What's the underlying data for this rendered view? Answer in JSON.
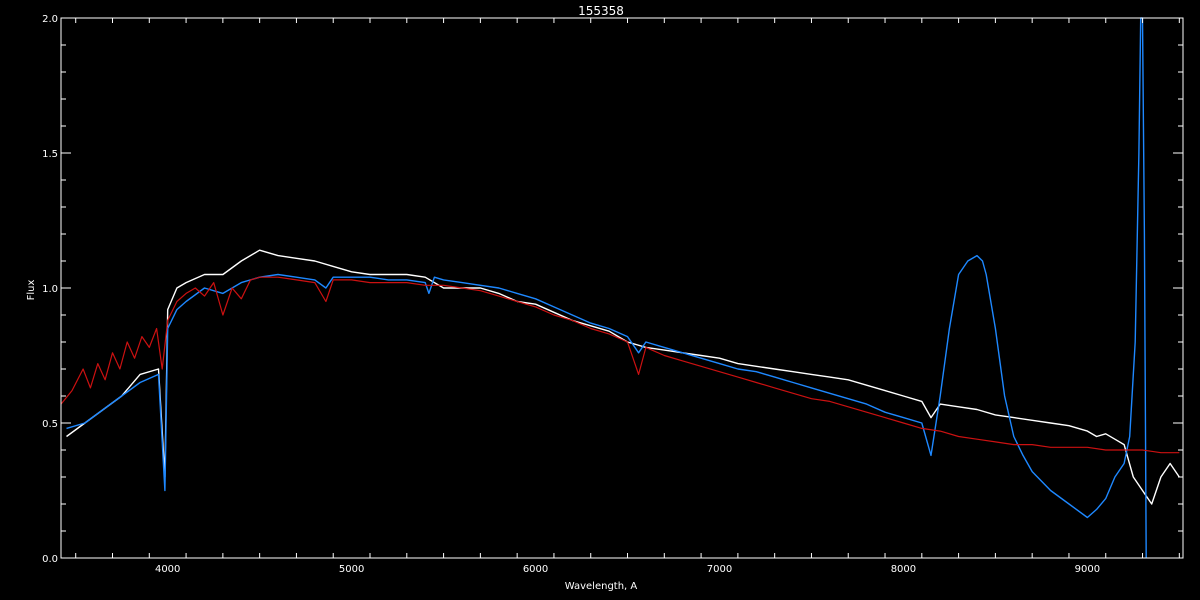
{
  "chart_data": {
    "type": "line",
    "title": "155358",
    "xlabel": "Wavelength, A",
    "ylabel": "Flux",
    "xlim": [
      3420,
      9520
    ],
    "ylim": [
      0.0,
      2.0
    ],
    "x_ticks": [
      4000,
      5000,
      6000,
      7000,
      8000,
      9000
    ],
    "x_tick_labels": [
      "4000",
      "5000",
      "6000",
      "7000",
      "8000",
      "9000"
    ],
    "y_ticks": [
      0.0,
      0.5,
      1.0,
      1.5,
      2.0
    ],
    "y_tick_labels": [
      "0.0",
      "0.5",
      "1.0",
      "1.5",
      "2.0"
    ],
    "grid": false,
    "background": "#000000",
    "series": [
      {
        "color": "#ffffff",
        "x": [
          3450,
          3550,
          3650,
          3750,
          3850,
          3950,
          3985,
          4000,
          4050,
          4100,
          4200,
          4300,
          4400,
          4500,
          4600,
          4700,
          4800,
          4900,
          5000,
          5100,
          5200,
          5300,
          5400,
          5500,
          5600,
          5700,
          5800,
          5900,
          6000,
          6100,
          6200,
          6300,
          6400,
          6500,
          6600,
          6700,
          6800,
          6900,
          7000,
          7100,
          7200,
          7300,
          7400,
          7500,
          7600,
          7700,
          7800,
          7900,
          8000,
          8100,
          8150,
          8200,
          8300,
          8400,
          8500,
          8600,
          8700,
          8800,
          8900,
          9000,
          9050,
          9100,
          9150,
          9200,
          9250,
          9300,
          9350,
          9400,
          9450,
          9500
        ],
        "y": [
          0.45,
          0.5,
          0.55,
          0.6,
          0.68,
          0.7,
          0.3,
          0.92,
          1.0,
          1.02,
          1.05,
          1.05,
          1.1,
          1.14,
          1.12,
          1.11,
          1.1,
          1.08,
          1.06,
          1.05,
          1.05,
          1.05,
          1.04,
          1.0,
          1.0,
          1.0,
          0.98,
          0.95,
          0.94,
          0.91,
          0.88,
          0.86,
          0.84,
          0.8,
          0.78,
          0.77,
          0.76,
          0.75,
          0.74,
          0.72,
          0.71,
          0.7,
          0.69,
          0.68,
          0.67,
          0.66,
          0.64,
          0.62,
          0.6,
          0.58,
          0.52,
          0.57,
          0.56,
          0.55,
          0.53,
          0.52,
          0.51,
          0.5,
          0.49,
          0.47,
          0.45,
          0.46,
          0.44,
          0.42,
          0.3,
          0.25,
          0.2,
          0.3,
          0.35,
          0.3
        ]
      },
      {
        "color": "#1e88ff",
        "x": [
          3450,
          3550,
          3650,
          3750,
          3850,
          3950,
          3985,
          4000,
          4050,
          4100,
          4200,
          4300,
          4400,
          4500,
          4600,
          4700,
          4800,
          4860,
          4900,
          5000,
          5100,
          5200,
          5300,
          5400,
          5420,
          5450,
          5500,
          5600,
          5700,
          5800,
          5900,
          6000,
          6100,
          6200,
          6300,
          6400,
          6500,
          6560,
          6600,
          6700,
          6800,
          6900,
          7000,
          7100,
          7200,
          7300,
          7400,
          7500,
          7600,
          7700,
          7800,
          7900,
          8000,
          8100,
          8150,
          8200,
          8250,
          8300,
          8350,
          8400,
          8430,
          8450,
          8500,
          8550,
          8600,
          8650,
          8700,
          8800,
          8900,
          9000,
          9050,
          9100,
          9150,
          9200,
          9230,
          9260,
          9280,
          9290,
          9300,
          9310,
          9320
        ],
        "y": [
          0.48,
          0.5,
          0.55,
          0.6,
          0.65,
          0.68,
          0.25,
          0.85,
          0.92,
          0.95,
          1.0,
          0.98,
          1.02,
          1.04,
          1.05,
          1.04,
          1.03,
          1.0,
          1.04,
          1.04,
          1.04,
          1.03,
          1.03,
          1.02,
          0.98,
          1.04,
          1.03,
          1.02,
          1.01,
          1.0,
          0.98,
          0.96,
          0.93,
          0.9,
          0.87,
          0.85,
          0.82,
          0.76,
          0.8,
          0.78,
          0.76,
          0.74,
          0.72,
          0.7,
          0.69,
          0.67,
          0.65,
          0.63,
          0.61,
          0.59,
          0.57,
          0.54,
          0.52,
          0.5,
          0.38,
          0.6,
          0.85,
          1.05,
          1.1,
          1.12,
          1.1,
          1.05,
          0.85,
          0.6,
          0.45,
          0.38,
          0.32,
          0.25,
          0.2,
          0.15,
          0.18,
          0.22,
          0.3,
          0.35,
          0.45,
          0.8,
          1.5,
          2.0,
          2.0,
          1.2,
          0.0
        ]
      },
      {
        "color": "#cc1111",
        "x": [
          3420,
          3480,
          3540,
          3580,
          3620,
          3660,
          3700,
          3740,
          3780,
          3820,
          3860,
          3900,
          3940,
          3970,
          4000,
          4050,
          4100,
          4150,
          4200,
          4250,
          4300,
          4350,
          4400,
          4450,
          4500,
          4600,
          4700,
          4800,
          4860,
          4900,
          5000,
          5100,
          5200,
          5300,
          5400,
          5500,
          5600,
          5700,
          5800,
          5900,
          6000,
          6100,
          6200,
          6300,
          6400,
          6500,
          6560,
          6600,
          6700,
          6800,
          6900,
          7000,
          7100,
          7200,
          7300,
          7400,
          7500,
          7600,
          7700,
          7800,
          7900,
          8000,
          8100,
          8200,
          8300,
          8400,
          8500,
          8600,
          8700,
          8800,
          8900,
          9000,
          9100,
          9200,
          9300,
          9400,
          9500
        ],
        "y": [
          0.57,
          0.62,
          0.7,
          0.63,
          0.72,
          0.66,
          0.76,
          0.7,
          0.8,
          0.74,
          0.82,
          0.78,
          0.85,
          0.7,
          0.88,
          0.95,
          0.98,
          1.0,
          0.97,
          1.02,
          0.9,
          1.0,
          0.96,
          1.03,
          1.04,
          1.04,
          1.03,
          1.02,
          0.95,
          1.03,
          1.03,
          1.02,
          1.02,
          1.02,
          1.01,
          1.01,
          1.0,
          0.99,
          0.97,
          0.95,
          0.93,
          0.9,
          0.88,
          0.85,
          0.83,
          0.8,
          0.68,
          0.78,
          0.75,
          0.73,
          0.71,
          0.69,
          0.67,
          0.65,
          0.63,
          0.61,
          0.59,
          0.58,
          0.56,
          0.54,
          0.52,
          0.5,
          0.48,
          0.47,
          0.45,
          0.44,
          0.43,
          0.42,
          0.42,
          0.41,
          0.41,
          0.41,
          0.4,
          0.4,
          0.4,
          0.39,
          0.39
        ]
      }
    ]
  }
}
